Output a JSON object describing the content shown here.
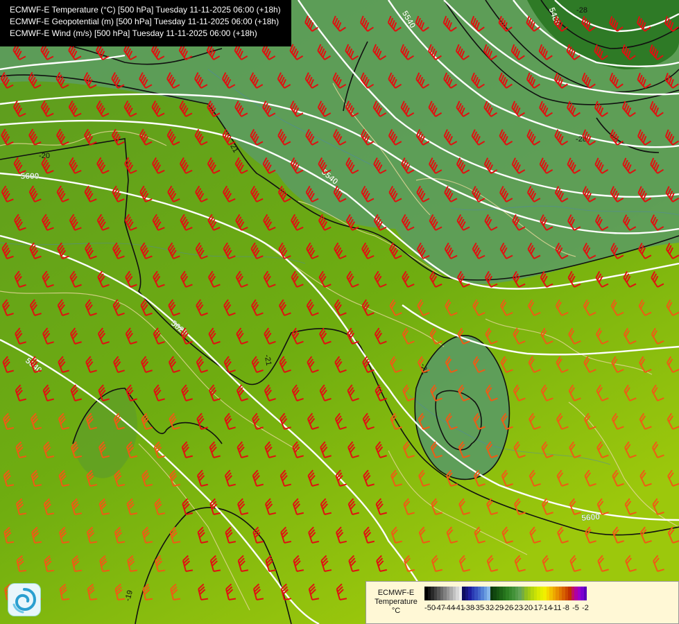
{
  "title_lines": [
    "ECMWF-E Temperature (°C) [500 hPa] Tuesday 11-11-2025 06:00 (+18h)",
    "ECMWF-E Geopotential (m) [500 hPa] Tuesday 11-11-2025 06:00 (+18h)",
    "ECMWF-E Wind (m/s) [500 hPa] Tuesday 11-11-2025 06:00 (+18h)"
  ],
  "geopotential_labels": [
    "5540",
    "5480",
    "5540",
    "5600",
    "5620",
    "5640",
    "5600"
  ],
  "temperature_labels": [
    "-20",
    "-21",
    "-28",
    "-28",
    "-21",
    "-21",
    "-19"
  ],
  "legend": {
    "name_lines": [
      "ECMWF-E",
      "Temperature",
      "°C"
    ],
    "ticks": [
      "-50",
      "-47",
      "-44",
      "-41",
      "-38",
      "-35",
      "-32",
      "-29",
      "-26",
      "-23",
      "-20",
      "-17",
      "-14",
      "-11",
      "-8",
      "-5",
      "-2"
    ],
    "colors": [
      "#000000",
      "#141414",
      "#2a2a2a",
      "#404040",
      "#555555",
      "#6b6b6b",
      "#808080",
      "#969696",
      "#ababab",
      "#c1c1c1",
      "#d6d6d6",
      "#ececec",
      "#0c0c60",
      "#151580",
      "#1e1ea0",
      "#2a3bb4",
      "#3650c0",
      "#4468cc",
      "#5482d6",
      "#6a9ce0",
      "#86b6ea",
      "#0c3a0c",
      "#11480f",
      "#175612",
      "#1d6416",
      "#24721b",
      "#2d7f22",
      "#37892d",
      "#439239",
      "#539b48",
      "#63a458",
      "#76ad3f",
      "#8fbf1f",
      "#a2cb14",
      "#b6d70c",
      "#c8e106",
      "#d8ea02",
      "#e6f000",
      "#f2ef00",
      "#f5d800",
      "#f2c000",
      "#eea800",
      "#e89000",
      "#e07800",
      "#d86000",
      "#cc4800",
      "#c03000",
      "#c01060",
      "#b000a0",
      "#9a00c8",
      "#7a00d0",
      "#5a00b8"
    ]
  },
  "colors": {
    "background": "#6aaa1e",
    "cold_core": "#5d9e62",
    "deep_core": "#2f7a2a",
    "isohypse": "#ffffff",
    "isotherm": "#101010",
    "barb_strong": "#e01010",
    "barb_moderate": "#f05a14"
  },
  "icons": {
    "logo": "swirl-logo-icon"
  }
}
